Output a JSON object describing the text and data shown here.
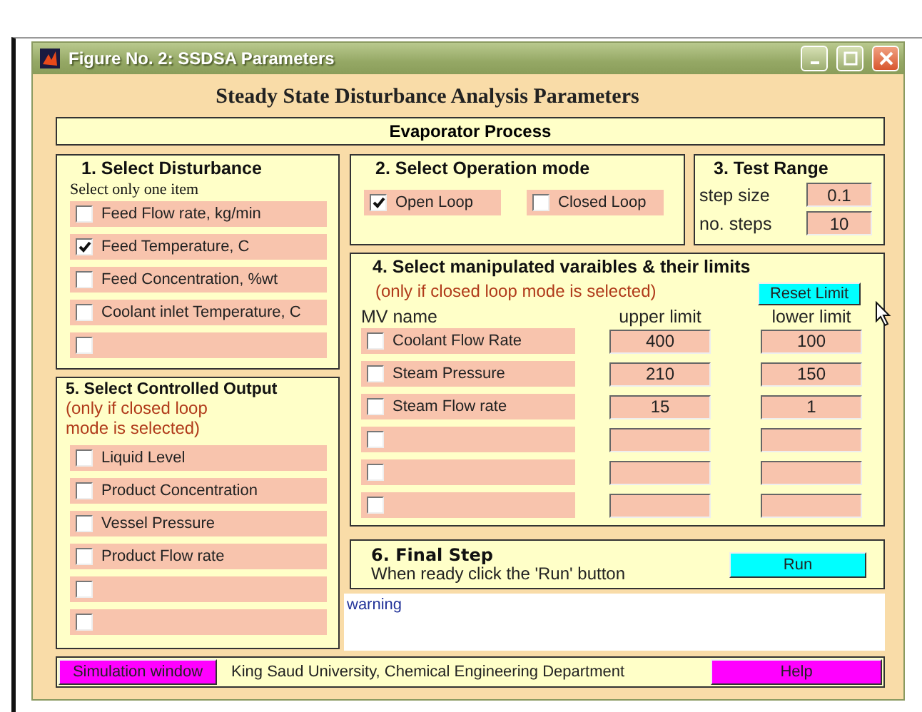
{
  "window": {
    "title": "Figure No.  2: SSDSA Parameters"
  },
  "heading": "Steady State Disturbance Analysis Parameters",
  "process_title": "Evaporator Process",
  "disturbance": {
    "title": "1. Select Disturbance",
    "hint": "Select only one item",
    "items": [
      {
        "label": "Feed Flow rate, kg/min",
        "checked": false
      },
      {
        "label": "Feed Temperature, C",
        "checked": true
      },
      {
        "label": "Feed Concentration, %wt",
        "checked": false
      },
      {
        "label": "Coolant inlet Temperature, C",
        "checked": false
      },
      {
        "checked": false
      }
    ]
  },
  "operation_mode": {
    "title": "2. Select Operation mode",
    "options": [
      {
        "label": "Open Loop",
        "checked": true
      },
      {
        "label": "Closed Loop",
        "checked": false
      }
    ]
  },
  "test_range": {
    "title": "3. Test Range",
    "fields": [
      {
        "label": "step size",
        "value": "0.1"
      },
      {
        "label": "no. steps",
        "value": "10"
      }
    ]
  },
  "manipulated": {
    "title": "4. Select manipulated varaibles & their limits",
    "note": "(only if closed loop mode is selected)",
    "reset_button": "Reset Limit",
    "columns": [
      "MV name",
      "upper limit",
      "lower limit"
    ],
    "rows": [
      {
        "name": "Coolant Flow Rate",
        "checked": false,
        "upper": "400",
        "lower": "100"
      },
      {
        "name": "Steam Pressure",
        "checked": false,
        "upper": "210",
        "lower": "150"
      },
      {
        "name": "Steam Flow rate",
        "checked": false,
        "upper": "15",
        "lower": "1"
      },
      {
        "checked": false
      },
      {
        "checked": false
      },
      {
        "checked": false
      }
    ]
  },
  "controlled_output": {
    "title": "5. Select Controlled Output",
    "note": "(only if closed loop mode is selected)",
    "items": [
      {
        "label": "Liquid Level",
        "checked": false
      },
      {
        "label": "Product Concentration",
        "checked": false
      },
      {
        "label": "Vessel Pressure",
        "checked": false
      },
      {
        "label": "Product Flow rate",
        "checked": false
      },
      {
        "checked": false
      },
      {
        "checked": false
      }
    ]
  },
  "final_step": {
    "title": "6. Final Step",
    "instruction": "When ready click the 'Run' button",
    "run_button": "Run"
  },
  "warning": "warning",
  "footer": {
    "simulation_button": "Simulation window",
    "credit": "King Saud University, Chemical Engineering Department",
    "help_button": "Help"
  }
}
